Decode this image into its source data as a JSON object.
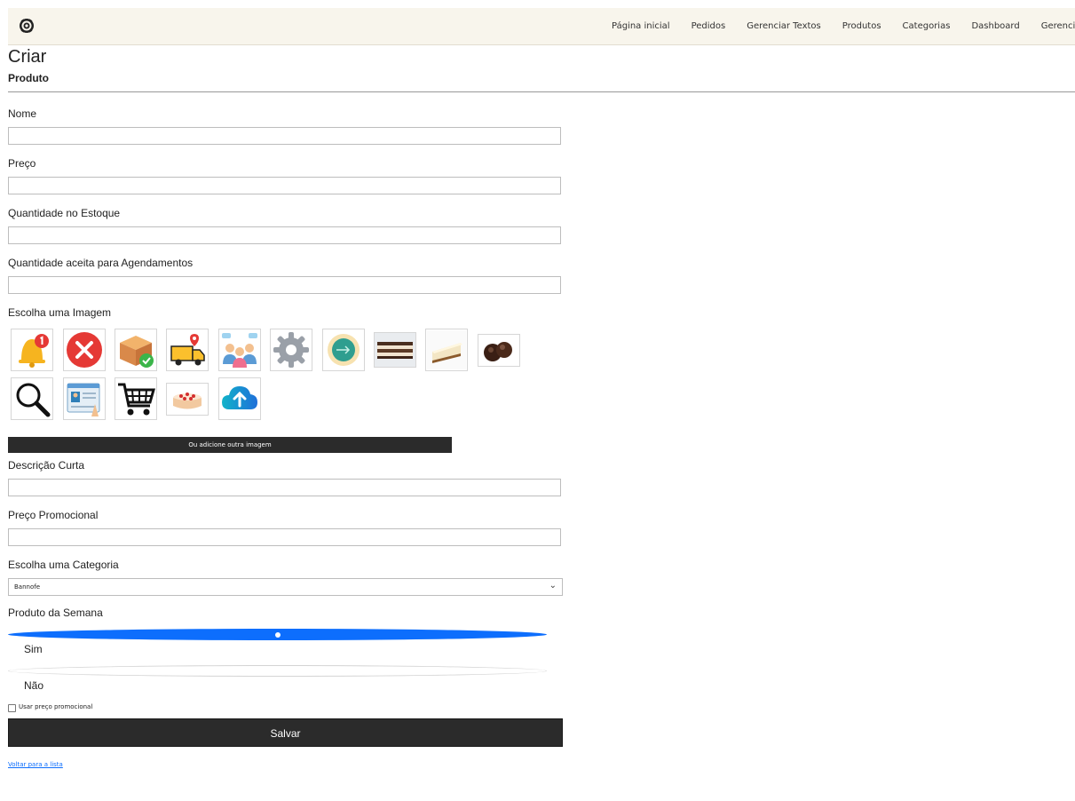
{
  "navbar": {
    "brand_icon": "rose-logo-icon",
    "links": [
      "Página inicial",
      "Pedidos",
      "Gerenciar Textos",
      "Produtos",
      "Categorias",
      "Dashboard",
      "Gerenciar Imagens"
    ]
  },
  "page": {
    "title": "Criar",
    "subtitle": "Produto"
  },
  "form": {
    "nome_label": "Nome",
    "preco_label": "Preço",
    "estoque_label": "Quantidade no Estoque",
    "agendamentos_label": "Quantidade aceita para Agendamentos",
    "imagem_label": "Escolha uma Imagem",
    "images": [
      {
        "icon": "notification-bell-icon"
      },
      {
        "icon": "red-x-icon"
      },
      {
        "icon": "box-check-icon"
      },
      {
        "icon": "delivery-truck-icon"
      },
      {
        "icon": "people-chat-icon"
      },
      {
        "icon": "gear-icon"
      },
      {
        "icon": "coin-arrow-icon"
      },
      {
        "icon": "layered-cake-photo"
      },
      {
        "icon": "cheesecake-slice-photo"
      },
      {
        "icon": "chocolate-bonbons-photo"
      },
      {
        "icon": "magnifier-icon"
      },
      {
        "icon": "profile-card-icon"
      },
      {
        "icon": "shopping-cart-icon"
      },
      {
        "icon": "strawberry-cake-photo"
      },
      {
        "icon": "cloud-upload-icon"
      }
    ],
    "add_image_button": "Ou adicione outra imagem",
    "descricao_label": "Descrição Curta",
    "preco_promo_label": "Preço Promocional",
    "categoria_label": "Escolha uma Categoria",
    "categoria_value": "Bannofe",
    "semana_label": "Produto da Semana",
    "radio_sim": "Sim",
    "radio_nao": "Não",
    "selected_radio": "Sim",
    "promo_checkbox_label": "Usar preço promocional",
    "promo_checked": false,
    "save_button": "Salvar",
    "back_link": "Voltar para a lista"
  },
  "colors": {
    "accent": "#0d6efd",
    "dark_button": "#2b2b2b",
    "navbar_bg": "#f8f5ec"
  }
}
